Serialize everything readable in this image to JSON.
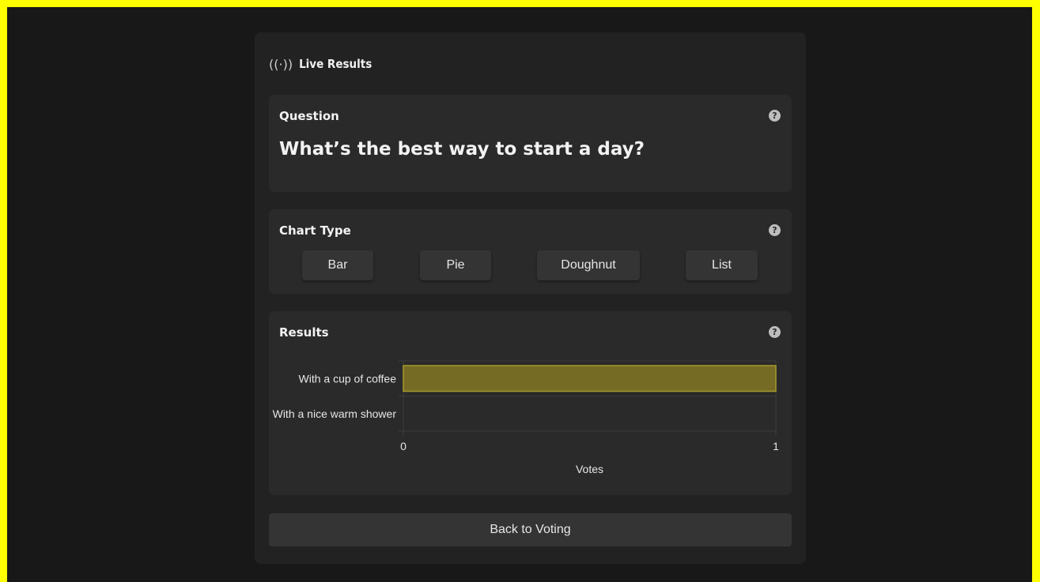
{
  "header": {
    "icon": "live-broadcast-icon",
    "title": "Live Results"
  },
  "question_card": {
    "label": "Question",
    "question": "What’s the best way to start a day?"
  },
  "chart_type_card": {
    "label": "Chart Type",
    "options": [
      "Bar",
      "Pie",
      "Doughnut",
      "List"
    ]
  },
  "results_card": {
    "label": "Results"
  },
  "actions": {
    "back_label": "Back to Voting"
  },
  "colors": {
    "bar_fill": "#756b25",
    "bar_border": "#a69a2c",
    "accent_frame": "#ffff00"
  },
  "chart_data": {
    "type": "bar",
    "orientation": "horizontal",
    "categories": [
      "With a cup of coffee",
      "With a nice warm shower"
    ],
    "values": [
      1,
      0
    ],
    "xlabel": "Votes",
    "xlim": [
      0,
      1
    ],
    "xticks": [
      "0",
      "1"
    ],
    "grid": true
  }
}
